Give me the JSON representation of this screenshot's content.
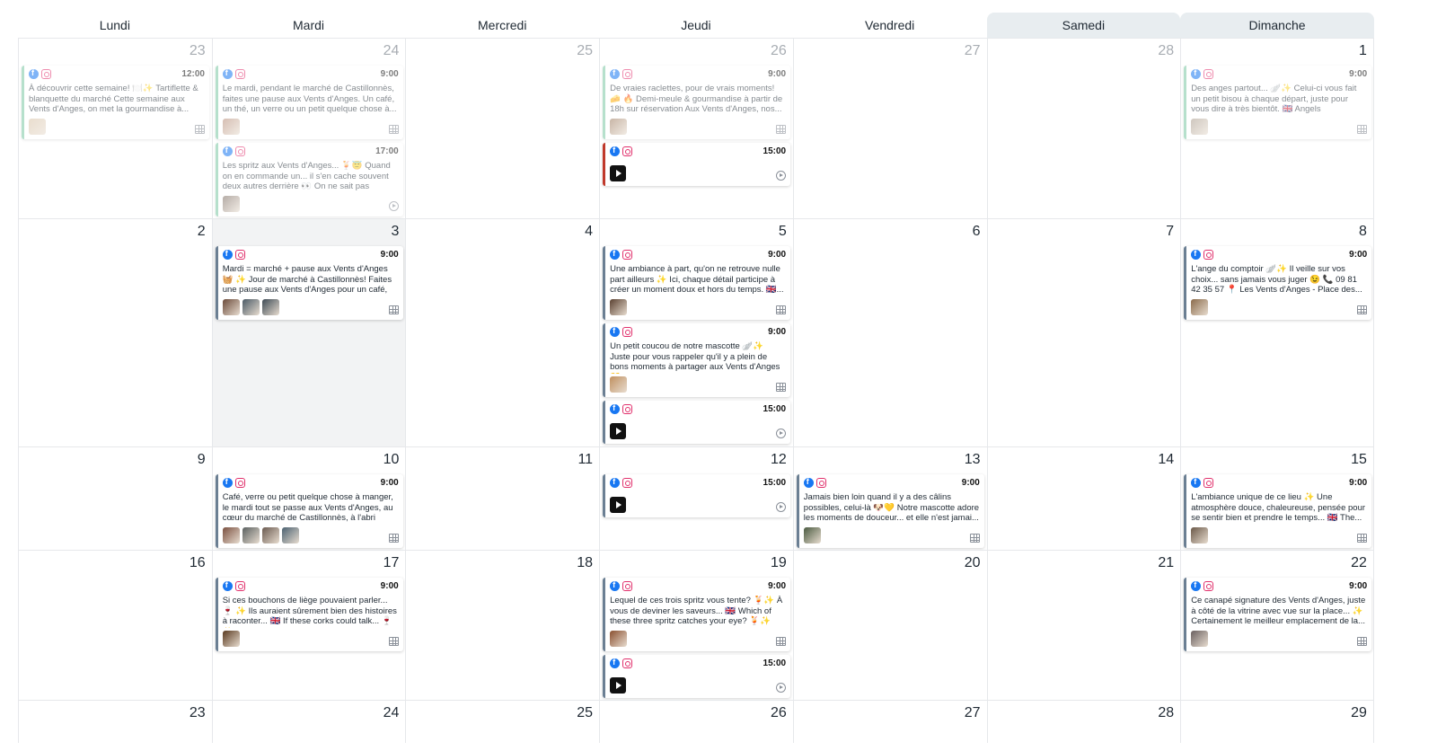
{
  "weekdays": [
    "Lundi",
    "Mardi",
    "Mercredi",
    "Jeudi",
    "Vendredi",
    "Samedi",
    "Dimanche"
  ],
  "weeks": [
    [
      "23",
      "24",
      "25",
      "26",
      "27",
      "28",
      "1"
    ],
    [
      "2",
      "3",
      "4",
      "5",
      "6",
      "7",
      "8"
    ],
    [
      "9",
      "10",
      "11",
      "12",
      "13",
      "14",
      "15"
    ],
    [
      "16",
      "17",
      "18",
      "19",
      "20",
      "21",
      "22"
    ],
    [
      "23",
      "24",
      "25",
      "26",
      "27",
      "28",
      "29"
    ]
  ],
  "posts": [
    {
      "week": 0,
      "day": 0,
      "time": "12:00",
      "text": "À découvrir cette semaine! 🍽️✨ Tartiflette & blanquette du marché Cette semaine aux Vents d'Anges, on met la gourmandise à...",
      "style": "past",
      "media": [
        "photo"
      ],
      "kind": "grid",
      "thumbs": [
        "#d9c2a6"
      ]
    },
    {
      "week": 0,
      "day": 1,
      "time": "9:00",
      "text": "Le mardi, pendant le marché de Castillonnès, faites une pause aux Vents d'Anges. Un café, un thé, un verre ou un petit quelque chose à...",
      "style": "past",
      "media": [
        "photo"
      ],
      "kind": "grid",
      "thumbs": [
        "#b58a76"
      ]
    },
    {
      "week": 0,
      "day": 1,
      "time": "17:00",
      "text": "Les spritz aux Vents d'Anges... 🍹😇 Quand on en commande un... il s'en cache souvent deux autres derrière 👀 On ne sait pas pourquoi....",
      "style": "past",
      "media": [
        "video"
      ],
      "kind": "reel",
      "thumbs": [
        "#7a6a60"
      ]
    },
    {
      "week": 0,
      "day": 3,
      "time": "9:00",
      "text": "De vraies raclettes, pour de vrais moments! 🧀 🔥 Demi-meule & gourmandise à partir de 18h sur réservation Aux Vents d'Anges, nos...",
      "style": "past",
      "media": [
        "photo"
      ],
      "kind": "grid",
      "thumbs": [
        "#9c7a5e"
      ]
    },
    {
      "week": 0,
      "day": 3,
      "time": "15:00",
      "text": "",
      "style": "red",
      "media": [
        "play"
      ],
      "kind": "reel",
      "thumbs": []
    },
    {
      "week": 0,
      "day": 6,
      "time": "9:00",
      "text": "Des anges partout... 🪽✨ Celui-ci vous fait un petit bisou à chaque départ, juste pour vous dire à très bientôt. 🇬🇧 Angels everywhere... ...",
      "style": "past",
      "media": [
        "photo"
      ],
      "kind": "grid",
      "thumbs": [
        "#a89a8c"
      ]
    },
    {
      "week": 1,
      "day": 1,
      "time": "9:00",
      "text": "Mardi = marché + pause aux Vents d'Anges 🧺 ✨ Jour de marché à Castillonnès! Faites une pause aux Vents d'Anges pour un café, un...",
      "style": "normal",
      "media": [
        "photo",
        "photo",
        "photo"
      ],
      "kind": "grid",
      "thumbs": [
        "#6b4a3a",
        "#4a5a66",
        "#3d4a55"
      ]
    },
    {
      "week": 1,
      "day": 3,
      "time": "9:00",
      "text": "Une ambiance à part, qu'on ne retrouve nulle part ailleurs ✨ Ici, chaque détail participe à créer un moment doux et hors du temps. 🇬🇧...",
      "style": "normal",
      "media": [
        "photo"
      ],
      "kind": "grid",
      "thumbs": [
        "#5a4030"
      ]
    },
    {
      "week": 1,
      "day": 3,
      "time": "9:00",
      "text": "Un petit coucou de notre mascotte 🪽✨ Juste pour vous rappeler qu'il y a plein de bons moments à partager aux Vents d'Anges 💛",
      "style": "normal",
      "media": [
        "photo"
      ],
      "kind": "grid",
      "thumbs": [
        "#c09060"
      ]
    },
    {
      "week": 1,
      "day": 3,
      "time": "15:00",
      "text": "",
      "style": "normal",
      "media": [
        "play"
      ],
      "kind": "reel",
      "thumbs": []
    },
    {
      "week": 1,
      "day": 6,
      "time": "9:00",
      "text": "L'ange du comptoir 🪽✨ Il veille sur vos choix... sans jamais vous juger 😉 📞 09 81 42 35 57 📍 Les Vents d'Anges - Place des...",
      "style": "normal",
      "media": [
        "photo"
      ],
      "kind": "grid",
      "thumbs": [
        "#8a6a4a"
      ]
    },
    {
      "week": 2,
      "day": 1,
      "time": "9:00",
      "text": "Café, verre ou petit quelque chose à manger, le mardi tout se passe aux Vents d'Anges, au cœur du marché de Castillonnès, à l'abri sou...",
      "style": "normal",
      "media": [
        "photo",
        "photo",
        "photo",
        "photo"
      ],
      "kind": "grid",
      "thumbs": [
        "#7a5040",
        "#5a6060",
        "#6a5a50",
        "#4a6070"
      ]
    },
    {
      "week": 2,
      "day": 3,
      "time": "15:00",
      "text": "",
      "style": "normal",
      "media": [
        "play"
      ],
      "kind": "reel",
      "thumbs": []
    },
    {
      "week": 2,
      "day": 4,
      "time": "9:00",
      "text": "Jamais bien loin quand il y a des câlins possibles, celui-là 🐶💛 Notre mascotte adore les moments de douceur... et elle n'est jamai...",
      "style": "normal",
      "media": [
        "photo"
      ],
      "kind": "grid",
      "thumbs": [
        "#4a5a40"
      ]
    },
    {
      "week": 2,
      "day": 6,
      "time": "9:00",
      "text": "L'ambiance unique de ce lieu ✨ Une atmosphère douce, chaleureuse, pensée pour se sentir bien et prendre le temps... 🇬🇧 The...",
      "style": "normal",
      "media": [
        "photo"
      ],
      "kind": "grid",
      "thumbs": [
        "#6a5848"
      ]
    },
    {
      "week": 3,
      "day": 1,
      "time": "9:00",
      "text": "Si ces bouchons de liège pouvaient parler... 🍷 ✨ Ils auraient sûrement bien des histoires à raconter... 🇬🇧 If these corks could talk... 🍷✨...",
      "style": "normal",
      "media": [
        "photo"
      ],
      "kind": "grid",
      "thumbs": [
        "#5a3a20"
      ]
    },
    {
      "week": 3,
      "day": 3,
      "time": "9:00",
      "text": "Lequel de ces trois spritz vous tente? 🍹✨ À vous de deviner les saveurs... 🇬🇧 Which of these three spritz catches your eye? 🍹✨ Ca...",
      "style": "normal",
      "media": [
        "photo"
      ],
      "kind": "grid",
      "thumbs": [
        "#8a5030"
      ]
    },
    {
      "week": 3,
      "day": 3,
      "time": "15:00",
      "text": "",
      "style": "normal",
      "media": [
        "play"
      ],
      "kind": "reel",
      "thumbs": []
    },
    {
      "week": 3,
      "day": 6,
      "time": "9:00",
      "text": "Ce canapé signature des Vents d'Anges, juste à côté de la vitrine avec vue sur la place... ✨ Certainement le meilleur emplacement de la...",
      "style": "normal",
      "media": [
        "photo"
      ],
      "kind": "grid",
      "thumbs": [
        "#6a6060"
      ]
    }
  ],
  "icons": {
    "facebook": "facebook-icon",
    "instagram": "instagram-icon",
    "grid": "grid-icon",
    "reel": "reel-icon"
  },
  "colors": {
    "past_accent": "#7cc7a4",
    "normal_accent": "#6b7f93",
    "alert_accent": "#c0392b",
    "weekend_header": "#e8edf0",
    "today_bg": "#f2f3f4"
  }
}
